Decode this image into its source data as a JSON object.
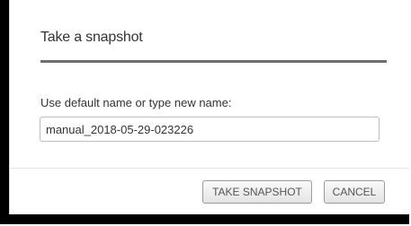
{
  "dialog": {
    "title": "Take a snapshot",
    "field_label": "Use default name or type new name:",
    "name_value": "manual_2018-05-29-023226",
    "take_snapshot_label": "TAKE SNAPSHOT",
    "cancel_label": "CANCEL"
  }
}
